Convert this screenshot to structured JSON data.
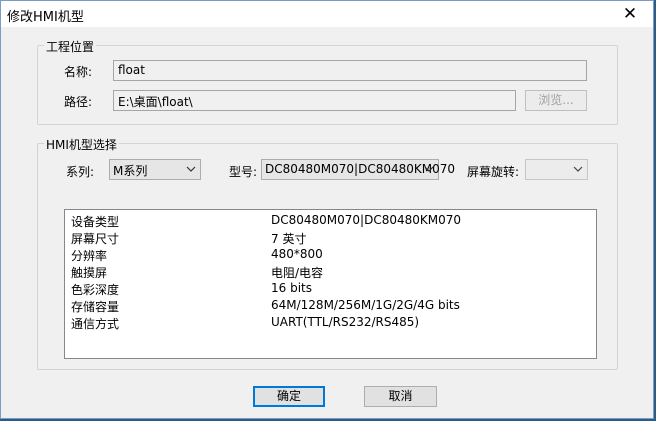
{
  "dialog": {
    "title": "修改HMI机型",
    "close_glyph": "✕"
  },
  "project_location": {
    "legend": "工程位置",
    "name_label": "名称:",
    "name_value": "float",
    "path_label": "路径:",
    "path_value": "E:\\桌面\\float\\",
    "browse_label": "浏览..."
  },
  "hmi_select": {
    "legend": "HMI机型选择",
    "series_label": "系列:",
    "series_value": "M系列",
    "model_label": "型号:",
    "model_value": "DC80480M070|DC80480KM070",
    "rotation_label": "屏幕旋转:",
    "rotation_value": ""
  },
  "specs": [
    {
      "key": "设备类型",
      "value": "DC80480M070|DC80480KM070"
    },
    {
      "key": "屏幕尺寸",
      "value": "7 英寸"
    },
    {
      "key": "分辨率",
      "value": "480*800"
    },
    {
      "key": "触摸屏",
      "value": "电阻/电容"
    },
    {
      "key": "色彩深度",
      "value": "16 bits"
    },
    {
      "key": "存储容量",
      "value": "64M/128M/256M/1G/2G/4G bits"
    },
    {
      "key": "通信方式",
      "value": "UART(TTL/RS232/RS485)"
    }
  ],
  "buttons": {
    "ok": "确定",
    "cancel": "取消"
  }
}
